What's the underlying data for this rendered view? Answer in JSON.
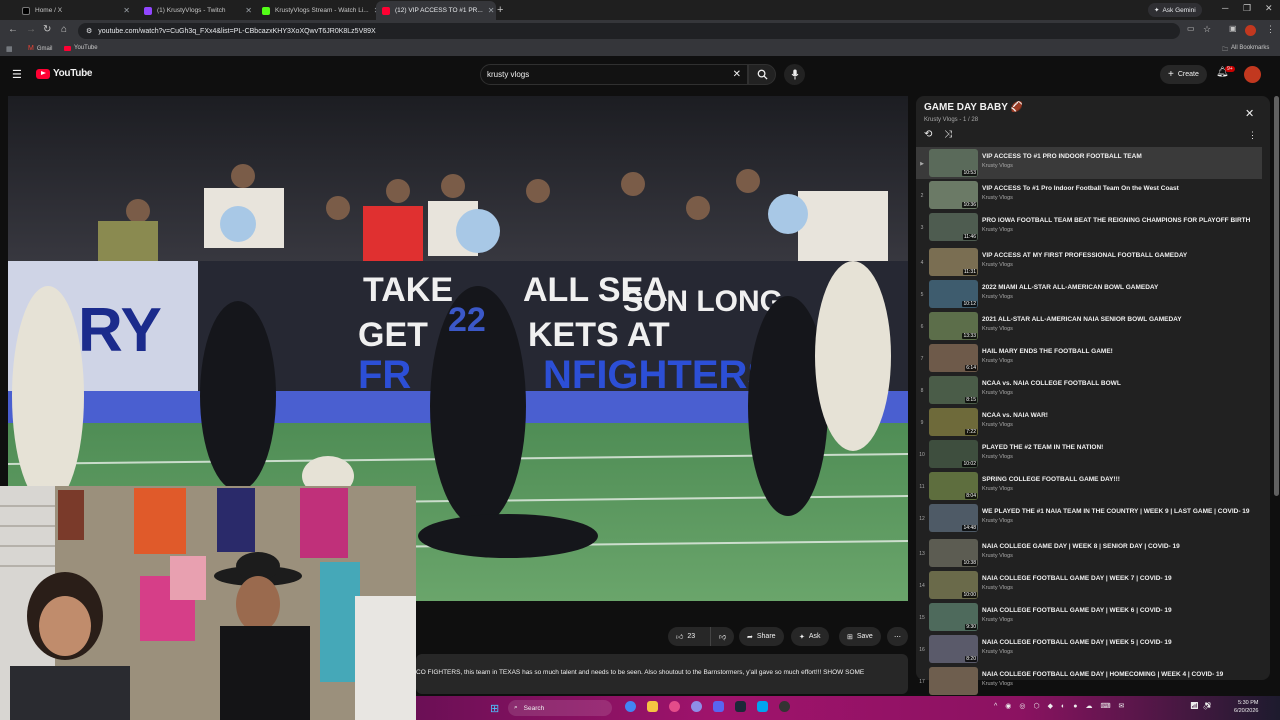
{
  "browser": {
    "tabs": [
      {
        "label": "Home / X",
        "favicon": "x-icon"
      },
      {
        "label": "(1) KrustyVlogs - Twitch",
        "favicon": "twitch-icon"
      },
      {
        "label": "KrustyVlogs Stream - Watch Li...",
        "favicon": "kick-icon"
      },
      {
        "label": "(12) VIP ACCESS TO #1 PR...",
        "favicon": "youtube-icon"
      }
    ],
    "ask_gemini": "Ask Gemini",
    "url": "youtube.com/watch?v=CuGh3q_FXx4&list=PL-CBbcazxKHY3XoXQwvT6JR0K8Lz5V89X",
    "bookmarks": [
      {
        "label": "Gmail"
      },
      {
        "label": "YouTube"
      }
    ],
    "all_bookmarks": "All Bookmarks"
  },
  "youtube": {
    "logo": "YouTube",
    "search_query": "krusty vlogs",
    "create_label": "Create",
    "notif_count": "9+"
  },
  "actions": {
    "likes": "23",
    "share": "Share",
    "ask": "Ask",
    "save": "Save"
  },
  "description": "CO FIGHTERS, this team in TEXAS has so much talent and needs to be seen. Also shoutout to the Barnstormers, y'all gave so much effort!!! SHOW SOME",
  "playlist": {
    "title": "GAME DAY BABY 🏈",
    "channel": "Krusty Vlogs",
    "position": "1 / 28",
    "items": [
      {
        "idx": "▶",
        "title": "VIP ACCESS TO #1 PRO INDOOR FOOTBALL TEAM",
        "channel": "Krusty Vlogs",
        "duration": "10:53"
      },
      {
        "idx": "2",
        "title": "VIP ACCESS To #1 Pro Indoor Football Team On the West Coast",
        "channel": "Krusty Vlogs",
        "duration": "10:36"
      },
      {
        "idx": "3",
        "title": "PRO IOWA FOOTBALL TEAM BEAT THE REIGNING CHAMPIONS FOR PLAYOFF BIRTH",
        "channel": "Krusty Vlogs",
        "duration": "11:46"
      },
      {
        "idx": "4",
        "title": "VIP ACCESS AT MY FIRST PROFESSIONAL FOOTBALL GAMEDAY",
        "channel": "Krusty Vlogs",
        "duration": "11:31"
      },
      {
        "idx": "5",
        "title": "2022 MIAMI ALL-STAR ALL-AMERICAN BOWL GAMEDAY",
        "channel": "Krusty Vlogs",
        "duration": "10:12"
      },
      {
        "idx": "6",
        "title": "2021 ALL-STAR ALL-AMERICAN NAIA SENIOR BOWL GAMEDAY",
        "channel": "Krusty Vlogs",
        "duration": "13:33"
      },
      {
        "idx": "7",
        "title": "HAIL MARY ENDS THE FOOTBALL GAME!",
        "channel": "Krusty Vlogs",
        "duration": "6:14"
      },
      {
        "idx": "8",
        "title": "NCAA vs. NAIA COLLEGE FOOTBALL BOWL",
        "channel": "Krusty Vlogs",
        "duration": "8:15"
      },
      {
        "idx": "9",
        "title": "NCAA vs. NAIA WAR!",
        "channel": "Krusty Vlogs",
        "duration": "7:22"
      },
      {
        "idx": "10",
        "title": "PLAYED THE #2 TEAM IN THE NATION!",
        "channel": "Krusty Vlogs",
        "duration": "10:02"
      },
      {
        "idx": "11",
        "title": "SPRING COLLEGE FOOTBALL GAME DAY!!!",
        "channel": "Krusty Vlogs",
        "duration": "8:04"
      },
      {
        "idx": "12",
        "title": "WE PLAYED THE #1 NAIA TEAM IN THE COUNTRY | WEEK 9 | LAST GAME | COVID- 19",
        "channel": "Krusty Vlogs",
        "duration": "14:48"
      },
      {
        "idx": "13",
        "title": "NAIA COLLEGE GAME DAY | WEEK 8 | SENIOR DAY | COVID- 19",
        "channel": "Krusty Vlogs",
        "duration": "10:38"
      },
      {
        "idx": "14",
        "title": "NAIA COLLEGE FOOTBALL GAME DAY | WEEK 7 | COVID- 19",
        "channel": "Krusty Vlogs",
        "duration": "10:00"
      },
      {
        "idx": "15",
        "title": "NAIA COLLEGE FOOTBALL GAME DAY | WEEK 6 | COVID- 19",
        "channel": "Krusty Vlogs",
        "duration": "9:30"
      },
      {
        "idx": "16",
        "title": "NAIA COLLEGE FOOTBALL GAME DAY | WEEK 5 | COVID- 19",
        "channel": "Krusty Vlogs",
        "duration": "8:20"
      },
      {
        "idx": "17",
        "title": "NAIA COLLEGE FOOTBALL GAME DAY | HOMECOMING | WEEK 4 | COVID- 19",
        "channel": "Krusty Vlogs",
        "duration": ""
      }
    ]
  },
  "video_overlay": {
    "banner_line1": "TAKE",
    "banner_line1b": "ALL SEA",
    "banner_line1c": "SON LONG",
    "banner_line2": "GET",
    "banner_line2b": "KETS AT",
    "banner_line3": "FR",
    "banner_line3b": "NFIGHTERS",
    "left_banner": "RY",
    "jersey_number": "22"
  },
  "taskbar": {
    "search": "Search",
    "time": "5:30 PM",
    "date": "6/20/2026"
  }
}
